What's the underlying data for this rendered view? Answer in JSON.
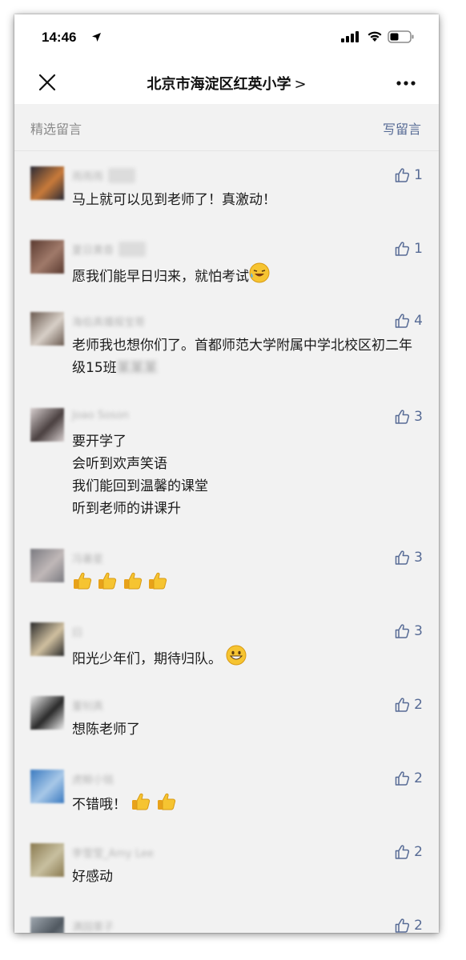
{
  "status_bar": {
    "time": "14:46"
  },
  "nav": {
    "title": "北京市海淀区红英小学",
    "chevron": ">"
  },
  "section": {
    "label": "精选留言",
    "write_label": "写留言"
  },
  "comments": [
    {
      "name": "雨雨雨",
      "name_tag": "作者",
      "text": "马上就可以见到老师了！真激动！",
      "likes": "1",
      "avatar_colors": [
        "#2a2a35",
        "#c87a3a"
      ]
    },
    {
      "name": "夏日黄昏",
      "name_tag": "作者",
      "text": "愿我们能早日归来，就怕考试",
      "likes": "1",
      "avatar_colors": [
        "#5a3a30",
        "#a07a6a"
      ]
    },
    {
      "name": "海伯真播报宝哥",
      "name_tag": "",
      "text": "老师我也想你们了。首都师范大学附属中学北校区初二年级15班",
      "text_blurred": "某某某",
      "likes": "4",
      "avatar_colors": [
        "#6a5a50",
        "#d8d0c8"
      ]
    },
    {
      "name": "Joao Soson",
      "name_tag": "",
      "text": "要开学了\n会听到欢声笑语\n我们能回到温馨的课堂\n听到老师的讲课升",
      "likes": "3",
      "avatar_colors": [
        "#d8d0d0",
        "#4a4040"
      ]
    },
    {
      "name": "冯暑星",
      "name_tag": "",
      "text": "",
      "likes": "3",
      "avatar_colors": [
        "#7a7a80",
        "#c0b8b8"
      ]
    },
    {
      "name": "曰",
      "name_tag": "",
      "text": "阳光少年们，期待归队。",
      "likes": "3",
      "avatar_colors": [
        "#2a2a2a",
        "#d0c0a0"
      ]
    },
    {
      "name": "董钊真",
      "name_tag": "",
      "text": "想陈老师了",
      "likes": "2",
      "avatar_colors": [
        "#f0f0f0",
        "#2a2a2a"
      ]
    },
    {
      "name": "虎鲸小铭",
      "name_tag": "",
      "text": "不错哦！",
      "likes": "2",
      "avatar_colors": [
        "#3a7ac0",
        "#a8c8e8"
      ]
    },
    {
      "name": "李雪莹_Amy Lee",
      "name_tag": "",
      "text": "好感动",
      "likes": "2",
      "avatar_colors": [
        "#8a7a50",
        "#c8c0a0"
      ]
    },
    {
      "name": "满园栗子",
      "name_tag": "",
      "text": "",
      "likes": "2",
      "avatar_colors": [
        "#a0a8b0",
        "#505860"
      ]
    }
  ]
}
